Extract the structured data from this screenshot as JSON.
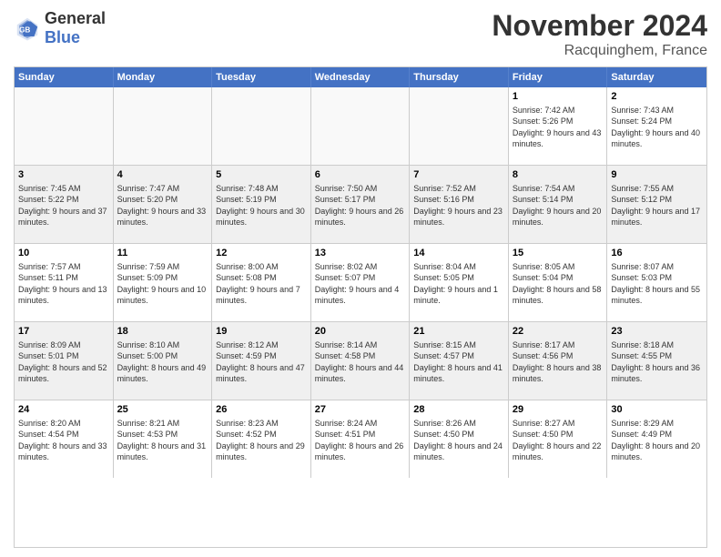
{
  "header": {
    "logo": {
      "general": "General",
      "blue": "Blue"
    },
    "title": "November 2024",
    "location": "Racquinghem, France"
  },
  "days_of_week": [
    "Sunday",
    "Monday",
    "Tuesday",
    "Wednesday",
    "Thursday",
    "Friday",
    "Saturday"
  ],
  "weeks": [
    {
      "id": "week1",
      "cells": [
        {
          "day": "",
          "empty": true
        },
        {
          "day": "",
          "empty": true
        },
        {
          "day": "",
          "empty": true
        },
        {
          "day": "",
          "empty": true
        },
        {
          "day": "",
          "empty": true
        },
        {
          "day": "1",
          "sunrise": "Sunrise: 7:42 AM",
          "sunset": "Sunset: 5:26 PM",
          "daylight": "Daylight: 9 hours and 43 minutes."
        },
        {
          "day": "2",
          "sunrise": "Sunrise: 7:43 AM",
          "sunset": "Sunset: 5:24 PM",
          "daylight": "Daylight: 9 hours and 40 minutes."
        }
      ]
    },
    {
      "id": "week2",
      "cells": [
        {
          "day": "3",
          "sunrise": "Sunrise: 7:45 AM",
          "sunset": "Sunset: 5:22 PM",
          "daylight": "Daylight: 9 hours and 37 minutes."
        },
        {
          "day": "4",
          "sunrise": "Sunrise: 7:47 AM",
          "sunset": "Sunset: 5:20 PM",
          "daylight": "Daylight: 9 hours and 33 minutes."
        },
        {
          "day": "5",
          "sunrise": "Sunrise: 7:48 AM",
          "sunset": "Sunset: 5:19 PM",
          "daylight": "Daylight: 9 hours and 30 minutes."
        },
        {
          "day": "6",
          "sunrise": "Sunrise: 7:50 AM",
          "sunset": "Sunset: 5:17 PM",
          "daylight": "Daylight: 9 hours and 26 minutes."
        },
        {
          "day": "7",
          "sunrise": "Sunrise: 7:52 AM",
          "sunset": "Sunset: 5:16 PM",
          "daylight": "Daylight: 9 hours and 23 minutes."
        },
        {
          "day": "8",
          "sunrise": "Sunrise: 7:54 AM",
          "sunset": "Sunset: 5:14 PM",
          "daylight": "Daylight: 9 hours and 20 minutes."
        },
        {
          "day": "9",
          "sunrise": "Sunrise: 7:55 AM",
          "sunset": "Sunset: 5:12 PM",
          "daylight": "Daylight: 9 hours and 17 minutes."
        }
      ]
    },
    {
      "id": "week3",
      "cells": [
        {
          "day": "10",
          "sunrise": "Sunrise: 7:57 AM",
          "sunset": "Sunset: 5:11 PM",
          "daylight": "Daylight: 9 hours and 13 minutes."
        },
        {
          "day": "11",
          "sunrise": "Sunrise: 7:59 AM",
          "sunset": "Sunset: 5:09 PM",
          "daylight": "Daylight: 9 hours and 10 minutes."
        },
        {
          "day": "12",
          "sunrise": "Sunrise: 8:00 AM",
          "sunset": "Sunset: 5:08 PM",
          "daylight": "Daylight: 9 hours and 7 minutes."
        },
        {
          "day": "13",
          "sunrise": "Sunrise: 8:02 AM",
          "sunset": "Sunset: 5:07 PM",
          "daylight": "Daylight: 9 hours and 4 minutes."
        },
        {
          "day": "14",
          "sunrise": "Sunrise: 8:04 AM",
          "sunset": "Sunset: 5:05 PM",
          "daylight": "Daylight: 9 hours and 1 minute."
        },
        {
          "day": "15",
          "sunrise": "Sunrise: 8:05 AM",
          "sunset": "Sunset: 5:04 PM",
          "daylight": "Daylight: 8 hours and 58 minutes."
        },
        {
          "day": "16",
          "sunrise": "Sunrise: 8:07 AM",
          "sunset": "Sunset: 5:03 PM",
          "daylight": "Daylight: 8 hours and 55 minutes."
        }
      ]
    },
    {
      "id": "week4",
      "cells": [
        {
          "day": "17",
          "sunrise": "Sunrise: 8:09 AM",
          "sunset": "Sunset: 5:01 PM",
          "daylight": "Daylight: 8 hours and 52 minutes."
        },
        {
          "day": "18",
          "sunrise": "Sunrise: 8:10 AM",
          "sunset": "Sunset: 5:00 PM",
          "daylight": "Daylight: 8 hours and 49 minutes."
        },
        {
          "day": "19",
          "sunrise": "Sunrise: 8:12 AM",
          "sunset": "Sunset: 4:59 PM",
          "daylight": "Daylight: 8 hours and 47 minutes."
        },
        {
          "day": "20",
          "sunrise": "Sunrise: 8:14 AM",
          "sunset": "Sunset: 4:58 PM",
          "daylight": "Daylight: 8 hours and 44 minutes."
        },
        {
          "day": "21",
          "sunrise": "Sunrise: 8:15 AM",
          "sunset": "Sunset: 4:57 PM",
          "daylight": "Daylight: 8 hours and 41 minutes."
        },
        {
          "day": "22",
          "sunrise": "Sunrise: 8:17 AM",
          "sunset": "Sunset: 4:56 PM",
          "daylight": "Daylight: 8 hours and 38 minutes."
        },
        {
          "day": "23",
          "sunrise": "Sunrise: 8:18 AM",
          "sunset": "Sunset: 4:55 PM",
          "daylight": "Daylight: 8 hours and 36 minutes."
        }
      ]
    },
    {
      "id": "week5",
      "cells": [
        {
          "day": "24",
          "sunrise": "Sunrise: 8:20 AM",
          "sunset": "Sunset: 4:54 PM",
          "daylight": "Daylight: 8 hours and 33 minutes."
        },
        {
          "day": "25",
          "sunrise": "Sunrise: 8:21 AM",
          "sunset": "Sunset: 4:53 PM",
          "daylight": "Daylight: 8 hours and 31 minutes."
        },
        {
          "day": "26",
          "sunrise": "Sunrise: 8:23 AM",
          "sunset": "Sunset: 4:52 PM",
          "daylight": "Daylight: 8 hours and 29 minutes."
        },
        {
          "day": "27",
          "sunrise": "Sunrise: 8:24 AM",
          "sunset": "Sunset: 4:51 PM",
          "daylight": "Daylight: 8 hours and 26 minutes."
        },
        {
          "day": "28",
          "sunrise": "Sunrise: 8:26 AM",
          "sunset": "Sunset: 4:50 PM",
          "daylight": "Daylight: 8 hours and 24 minutes."
        },
        {
          "day": "29",
          "sunrise": "Sunrise: 8:27 AM",
          "sunset": "Sunset: 4:50 PM",
          "daylight": "Daylight: 8 hours and 22 minutes."
        },
        {
          "day": "30",
          "sunrise": "Sunrise: 8:29 AM",
          "sunset": "Sunset: 4:49 PM",
          "daylight": "Daylight: 8 hours and 20 minutes."
        }
      ]
    }
  ]
}
